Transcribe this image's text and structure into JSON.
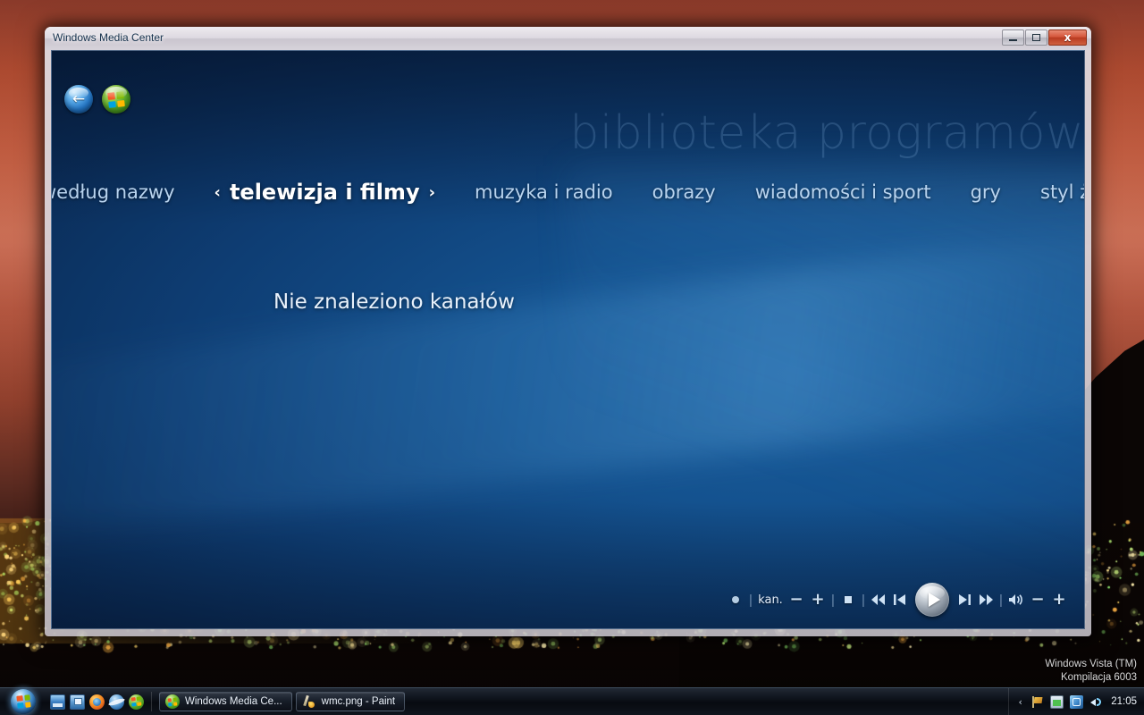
{
  "desktop": {
    "watermark_line1": "Windows Vista (TM)",
    "watermark_line2": "Kompilacja 6003",
    "sky_color": "#b9543a",
    "ground_color": "#0a0504"
  },
  "window": {
    "title": "Windows Media Center",
    "buttons": {
      "minimize": "minimize",
      "maximize": "maximize",
      "close": "x"
    }
  },
  "wmc": {
    "back_label": "←",
    "start_label": "start",
    "heading": "biblioteka programów",
    "nav": [
      {
        "label": "według nazwy",
        "active": false
      },
      {
        "label": "telewizja i filmy",
        "active": true
      },
      {
        "label": "muzyka i radio",
        "active": false
      },
      {
        "label": "obrazy",
        "active": false
      },
      {
        "label": "wiadomości i sport",
        "active": false
      },
      {
        "label": "gry",
        "active": false
      },
      {
        "label": "styl życi",
        "active": false
      }
    ],
    "nav_left_chevron": "‹",
    "nav_right_chevron": "›",
    "message": "Nie znaleziono kanałów",
    "accent_color": "#1b5e9e"
  },
  "transport": {
    "record_label": "record",
    "channel_label": "kan.",
    "channel_down": "−",
    "channel_up": "+",
    "stop_label": "stop",
    "rewind": "◀◀",
    "previous": "|◀",
    "play": "play",
    "next": "▶|",
    "forward": "▶▶",
    "mute": "volume",
    "volume_down": "−",
    "volume_up": "+",
    "separator": "|"
  },
  "taskbar": {
    "start_label": "Start",
    "quicklaunch": [
      {
        "name": "show-desktop-icon"
      },
      {
        "name": "switch-window-icon"
      },
      {
        "name": "firefox-icon"
      },
      {
        "name": "internet-explorer-icon"
      },
      {
        "name": "windows-media-center-icon"
      }
    ],
    "tasks": [
      {
        "label": "Windows Media Ce...",
        "icon": "windows-media-center-icon",
        "active": true
      },
      {
        "label": "wmc.png - Paint",
        "icon": "paint-icon",
        "active": false
      }
    ],
    "tray": {
      "chevron": "‹",
      "icons": [
        "flag-icon",
        "battery-icon",
        "network-icon",
        "volume-icon"
      ],
      "clock": "21:05"
    }
  }
}
